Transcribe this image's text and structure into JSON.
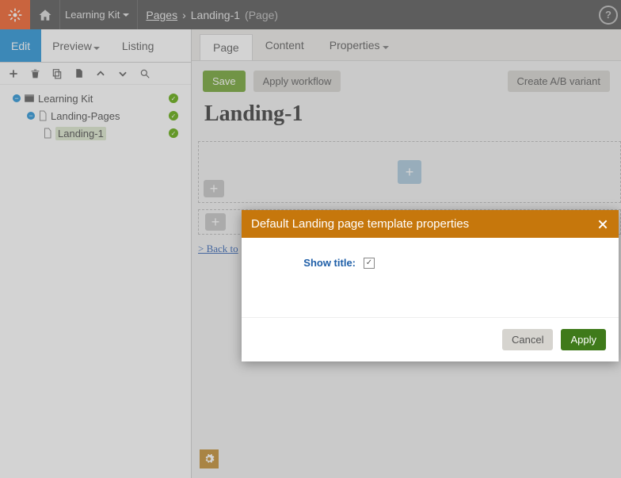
{
  "topbar": {
    "site_name": "Learning Kit",
    "bc_link": "Pages",
    "bc_current": "Landing-1",
    "bc_type": "(Page)",
    "help": "?"
  },
  "left_panel": {
    "tabs": {
      "edit": "Edit",
      "preview": "Preview",
      "listing": "Listing"
    },
    "tree": {
      "root": "Learning Kit",
      "child1": "Landing-Pages",
      "child2": "Landing-1"
    }
  },
  "main": {
    "tabs": {
      "page": "Page",
      "content": "Content",
      "properties": "Properties"
    },
    "actions": {
      "save": "Save",
      "apply_workflow": "Apply workflow",
      "create_ab": "Create A/B variant"
    },
    "page_title": "Landing-1",
    "back_link": "> Back to",
    "add_plus": "+"
  },
  "modal": {
    "title": "Default Landing page template properties",
    "field_label": "Show title:",
    "checked": true,
    "cancel": "Cancel",
    "apply": "Apply"
  }
}
